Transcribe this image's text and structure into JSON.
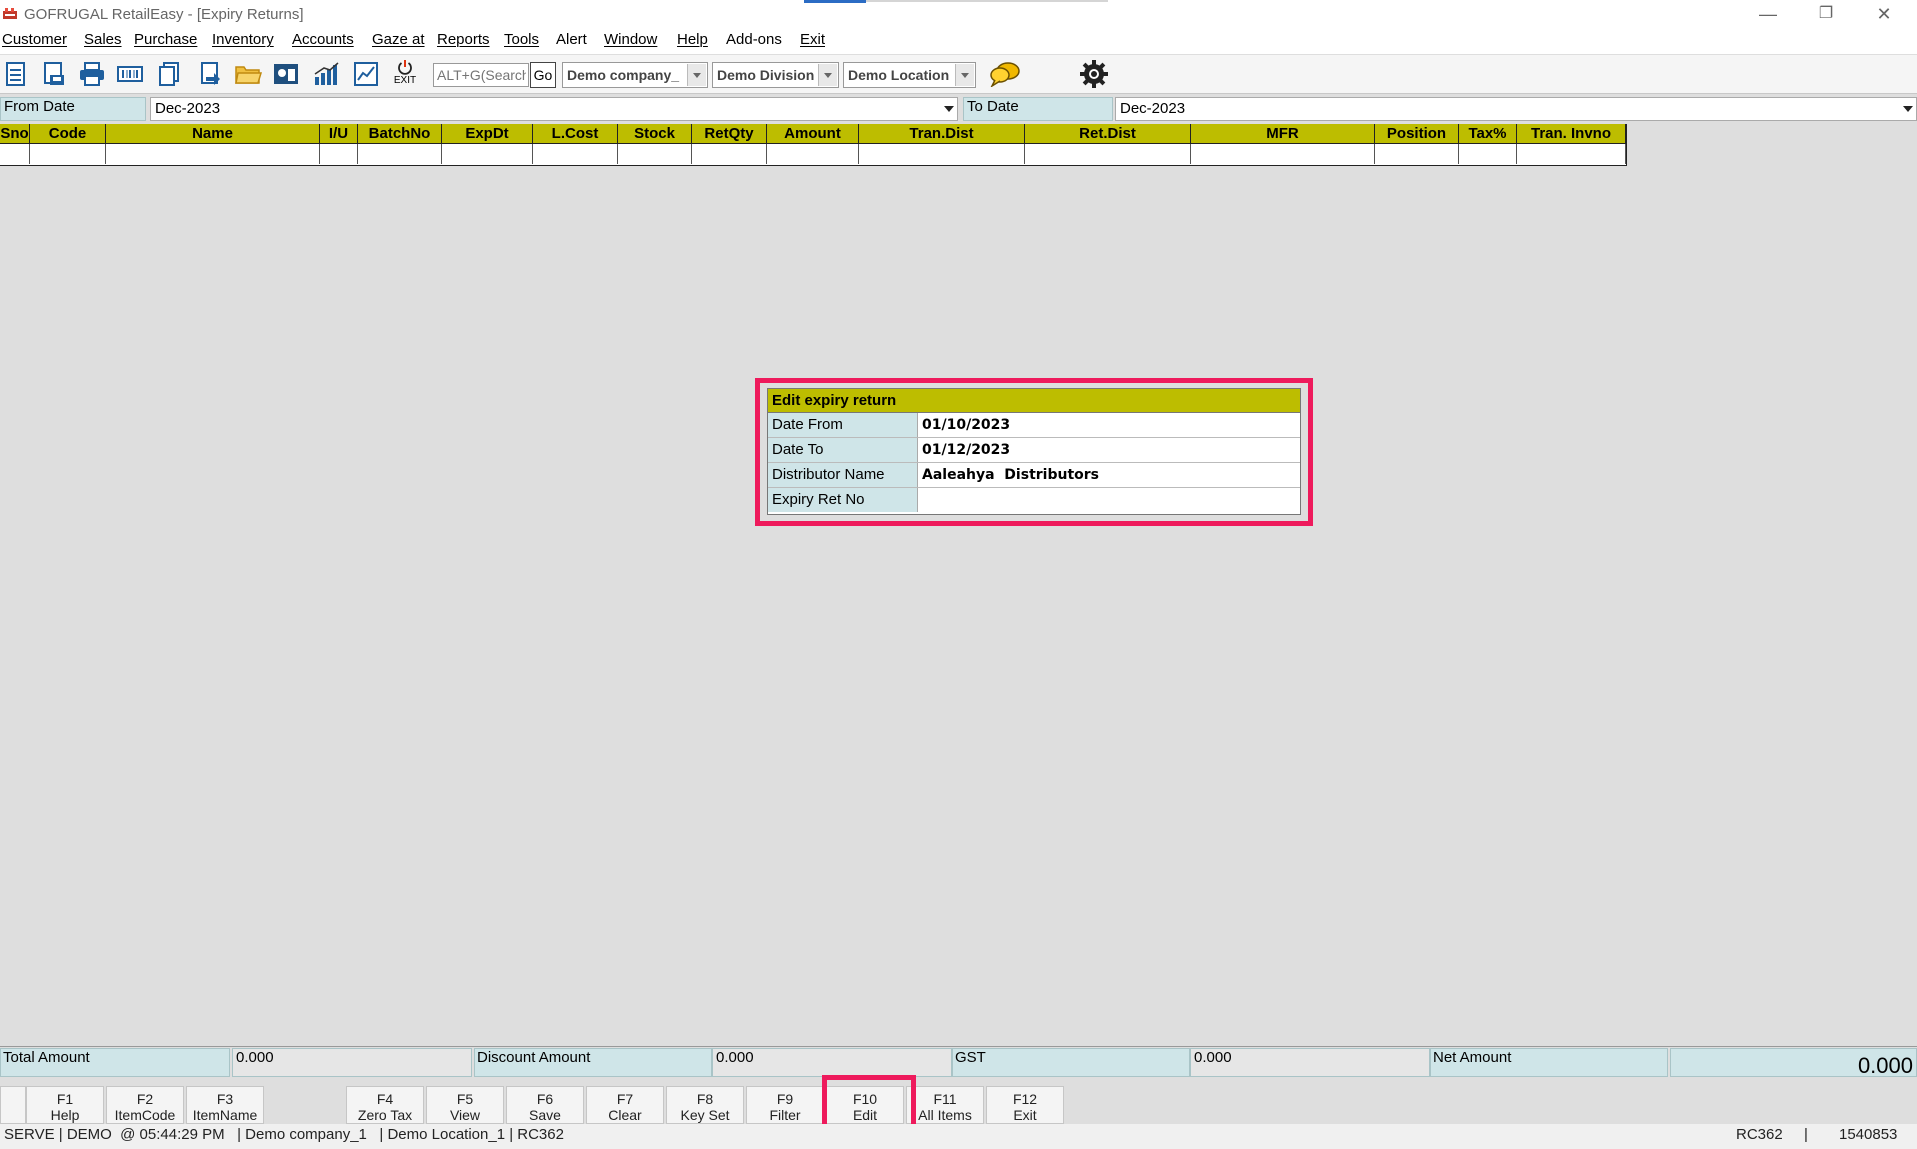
{
  "window": {
    "title": "GOFRUGAL RetailEasy - [Expiry Returns]",
    "minimize": "—",
    "restore": "❐",
    "close": "✕"
  },
  "menu": [
    "Customer",
    "Sales",
    "Purchase",
    "Inventory",
    "Accounts",
    "Gaze at",
    "Reports",
    "Tools",
    "Alert",
    "Window",
    "Help",
    "Add-ons",
    "Exit"
  ],
  "toolbar": {
    "search_placeholder": "ALT+G(Search)",
    "go_label": "Go",
    "exit_label": "EXIT",
    "company": "Demo company_",
    "division": "Demo Division",
    "location": "Demo Location"
  },
  "filters": {
    "from_label": "From Date",
    "from_value": "Dec-2023",
    "to_label": "To Date",
    "to_value": "Dec-2023"
  },
  "grid": {
    "columns": [
      "Sno",
      "Code",
      "Name",
      "I/U",
      "BatchNo",
      "ExpDt",
      "L.Cost",
      "Stock",
      "RetQty",
      "Amount",
      "Tran.Dist",
      "Ret.Dist",
      "MFR",
      "Position",
      "Tax%",
      "Tran. Invno"
    ]
  },
  "dialog": {
    "title": "Edit expiry return",
    "rows": [
      {
        "label": "Date From",
        "value": "01/10/2023"
      },
      {
        "label": "Date To",
        "value": "01/12/2023"
      },
      {
        "label": "Distributor Name",
        "value": "Aaleahya  Distributors"
      },
      {
        "label": "Expiry Ret No",
        "value": ""
      }
    ]
  },
  "totals": {
    "total_label": "Total Amount",
    "total_value": "0.000",
    "discount_label": "Discount Amount",
    "discount_value": "0.000",
    "gst_label": "GST",
    "gst_value": "0.000",
    "net_label": "Net Amount",
    "net_value": "0.000"
  },
  "fkeys": [
    {
      "key": "F1",
      "label": "Help"
    },
    {
      "key": "F2",
      "label": "ItemCode"
    },
    {
      "key": "F3",
      "label": "ItemName"
    },
    {
      "key": "F4",
      "label": "Zero Tax"
    },
    {
      "key": "F5",
      "label": "View"
    },
    {
      "key": "F6",
      "label": "Save"
    },
    {
      "key": "F7",
      "label": "Clear"
    },
    {
      "key": "F8",
      "label": "Key Set"
    },
    {
      "key": "F9",
      "label": "Filter"
    },
    {
      "key": "F10",
      "label": "Edit"
    },
    {
      "key": "F11",
      "label": "All Items"
    },
    {
      "key": "F12",
      "label": "Exit"
    }
  ],
  "status": {
    "left": "SERVE | DEMO  @ 05:44:29 PM   | Demo company_1   | Demo Location_1 | RC362",
    "code": "RC362",
    "sep": "|",
    "number": "1540853"
  },
  "colors": {
    "header_yellow": "#bdbd00",
    "label_cyan": "#cfe5e8",
    "highlight": "#ee1a5c"
  }
}
